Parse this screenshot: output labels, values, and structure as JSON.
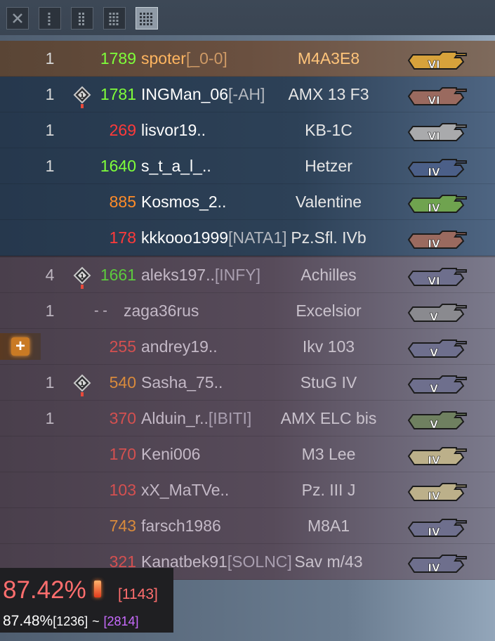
{
  "toolbar": {
    "buttons": [
      {
        "icon": "close-icon",
        "active": false
      },
      {
        "icon": "columns-1-icon",
        "active": false
      },
      {
        "icon": "columns-2-icon",
        "active": false
      },
      {
        "icon": "columns-3-icon",
        "active": false
      },
      {
        "icon": "columns-4-icon",
        "active": true
      }
    ]
  },
  "colors": {
    "rating_green": "#7fff3a",
    "rating_lightgreen": "#5ccb3d",
    "rating_orange": "#ff8c29",
    "rating_red": "#ff3a3a",
    "rating_dimred": "#d45050",
    "self_name": "#ffb560",
    "tier_gold": "#d7a23b",
    "tier_brown": "#9a6a5f",
    "tier_grey": "#a9aaac",
    "tier_blue": "#4b5f88",
    "tier_green": "#6fa34f",
    "tier_olive": "#bcb08a",
    "tier_lavender": "#6e6f8d"
  },
  "allies": [
    {
      "squad": "1",
      "badge": false,
      "rating": "1789",
      "rating_color": "#7fff3a",
      "name": "spoter",
      "clan": "[_0-0]",
      "tank": "M4A3E8",
      "tier": "VI",
      "tier_color": "#d7a23b",
      "self": true
    },
    {
      "squad": "1",
      "badge": true,
      "rating": "1781",
      "rating_color": "#7fff3a",
      "name": "INGMan_06",
      "clan": "[-AH]",
      "tank": "AMX 13 F3",
      "tier": "VI",
      "tier_color": "#9a6a5f",
      "self": false
    },
    {
      "squad": "1",
      "badge": false,
      "rating": "269",
      "rating_color": "#ff3a3a",
      "name": "lisvor19..",
      "clan": "",
      "tank": "KB-1C",
      "tier": "VI",
      "tier_color": "#a9aaac",
      "self": false
    },
    {
      "squad": "1",
      "badge": false,
      "rating": "1640",
      "rating_color": "#7fff3a",
      "name": "s_t_a_l_..",
      "clan": "",
      "tank": "Hetzer",
      "tier": "IV",
      "tier_color": "#4b5f88",
      "self": false
    },
    {
      "squad": "",
      "badge": false,
      "rating": "885",
      "rating_color": "#ff8c29",
      "name": "Kosmos_2..",
      "clan": "",
      "tank": "Valentine",
      "tier": "IV",
      "tier_color": "#6fa34f",
      "self": false
    },
    {
      "squad": "",
      "badge": false,
      "rating": "178",
      "rating_color": "#ff3a3a",
      "name": "kkkooo1999",
      "clan": "[NATA1]",
      "tank": "Pz.Sfl. IVb",
      "tier": "IV",
      "tier_color": "#9a6a5f",
      "self": false
    }
  ],
  "enemies": [
    {
      "squad": "4",
      "badge": true,
      "rating": "1661",
      "rating_color": "#5ccb3d",
      "name": "aleks197..",
      "clan": "[INFY]",
      "tank": "Achilles",
      "tier": "VI",
      "tier_color": "#6e6f8d",
      "medic": false
    },
    {
      "squad": "1",
      "badge": false,
      "rating": "- -",
      "rating_color": "#c3b8c6",
      "name": "zaga36rus",
      "clan": "",
      "tank": "Excelsior",
      "tier": "V",
      "tier_color": "#8a8a8f",
      "medic": false
    },
    {
      "squad": "",
      "badge": false,
      "rating": "255",
      "rating_color": "#d45050",
      "name": "andrey19..",
      "clan": "",
      "tank": "Ikv 103",
      "tier": "V",
      "tier_color": "#6e6f8d",
      "medic": true
    },
    {
      "squad": "1",
      "badge": true,
      "rating": "540",
      "rating_color": "#d88a3c",
      "name": "Sasha_75..",
      "clan": "",
      "tank": "StuG IV",
      "tier": "V",
      "tier_color": "#6e6f8d",
      "medic": false
    },
    {
      "squad": "1",
      "badge": false,
      "rating": "370",
      "rating_color": "#d45050",
      "name": "Alduin_r..",
      "clan": "[IBITI]",
      "tank": "AMX ELC bis",
      "tier": "V",
      "tier_color": "#6f8060",
      "medic": false
    },
    {
      "squad": "",
      "badge": false,
      "rating": "170",
      "rating_color": "#d45050",
      "name": "Keni006",
      "clan": "",
      "tank": "M3 Lee",
      "tier": "IV",
      "tier_color": "#bcb08a",
      "medic": false
    },
    {
      "squad": "",
      "badge": false,
      "rating": "103",
      "rating_color": "#d45050",
      "name": "xX_MaTVe..",
      "clan": "",
      "tank": "Pz. III J",
      "tier": "IV",
      "tier_color": "#bcb08a",
      "medic": false
    },
    {
      "squad": "",
      "badge": false,
      "rating": "743",
      "rating_color": "#d88a3c",
      "name": "farsch1986",
      "clan": "",
      "tank": "M8A1",
      "tier": "IV",
      "tier_color": "#6e6f8d",
      "medic": false
    },
    {
      "squad": "",
      "badge": false,
      "rating": "321",
      "rating_color": "#d45050",
      "name": "Kanatbek91",
      "clan": "[SOLNC]",
      "tank": "Sav m/43",
      "tier": "IV",
      "tier_color": "#6e6f8d",
      "medic": false
    }
  ],
  "stats": {
    "main_percent": "87.42%",
    "main_bracket": "[1143]",
    "second_percent": "87.48%",
    "second_bracket": "[1236]",
    "tilde": "~",
    "rating_bracket": "[2814]"
  }
}
